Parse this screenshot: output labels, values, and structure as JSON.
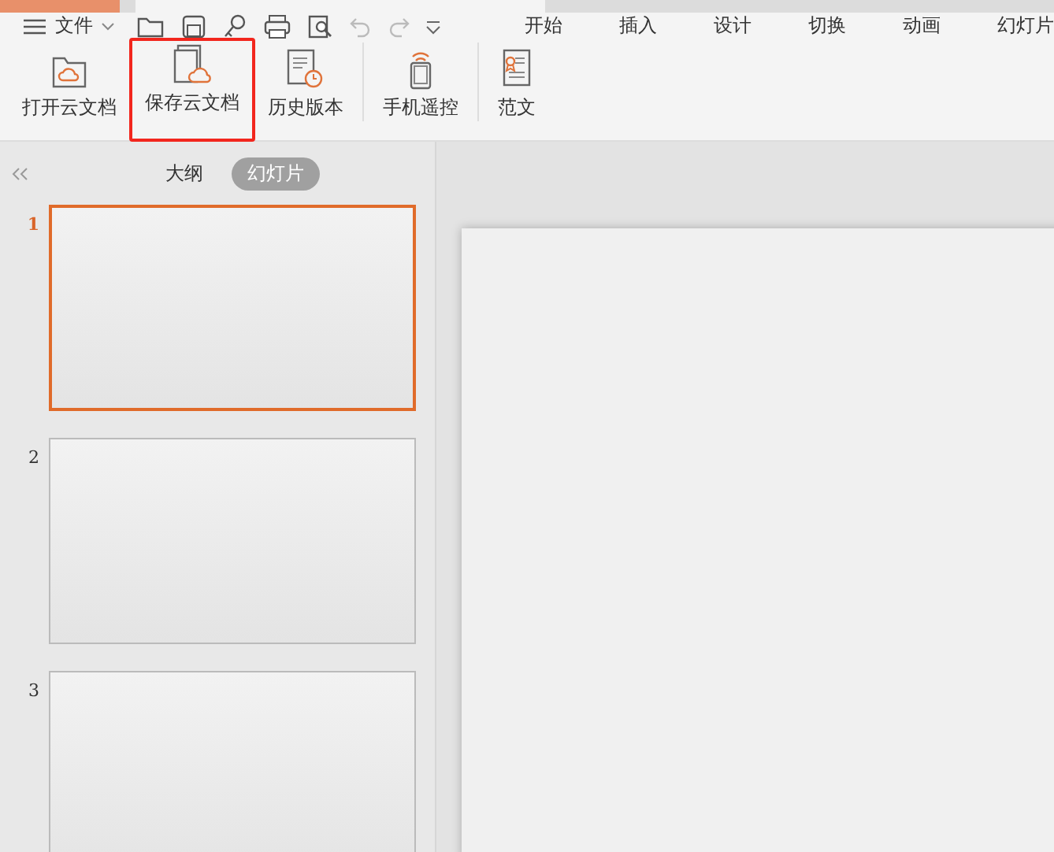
{
  "menu": {
    "label": "文件"
  },
  "ribbon_tabs": [
    {
      "label": "开始"
    },
    {
      "label": "插入"
    },
    {
      "label": "设计"
    },
    {
      "label": "切换"
    },
    {
      "label": "动画"
    },
    {
      "label": "幻灯片"
    }
  ],
  "ribbon": [
    {
      "label": "打开云文档",
      "kind": "open-cloud",
      "highlighted": false
    },
    {
      "label": "保存云文档",
      "kind": "save-cloud",
      "highlighted": true
    },
    {
      "label": "历史版本",
      "kind": "history",
      "highlighted": false
    },
    {
      "label": "手机遥控",
      "kind": "phone",
      "highlighted": false
    },
    {
      "label": "范文",
      "kind": "template",
      "highlighted": false
    }
  ],
  "panel_tabs": [
    {
      "label": "大纲",
      "selected": false
    },
    {
      "label": "幻灯片",
      "selected": true
    }
  ],
  "slides": [
    {
      "number": "1",
      "selected": true
    },
    {
      "number": "2",
      "selected": false
    },
    {
      "number": "3",
      "selected": false
    }
  ]
}
